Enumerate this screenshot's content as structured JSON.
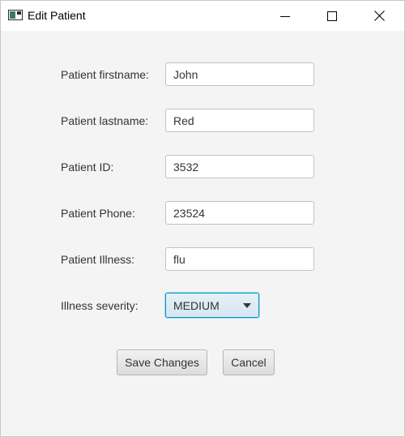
{
  "window": {
    "title": "Edit Patient",
    "controls": {
      "minimize_icon": "minimize-icon",
      "maximize_icon": "maximize-icon",
      "close_icon": "close-icon"
    }
  },
  "form": {
    "fields": [
      {
        "label": "Patient firstname:",
        "value": "John"
      },
      {
        "label": "Patient lastname:",
        "value": "Red"
      },
      {
        "label": "Patient ID:",
        "value": "3532"
      },
      {
        "label": "Patient Phone:",
        "value": "23524"
      },
      {
        "label": "Patient Illness:",
        "value": "flu"
      }
    ],
    "severity": {
      "label": "Illness severity:",
      "selected": "MEDIUM"
    }
  },
  "actions": {
    "save_label": "Save Changes",
    "cancel_label": "Cancel"
  },
  "colors": {
    "focus_accent": "#0096c9",
    "window_background": "#f4f4f4"
  }
}
